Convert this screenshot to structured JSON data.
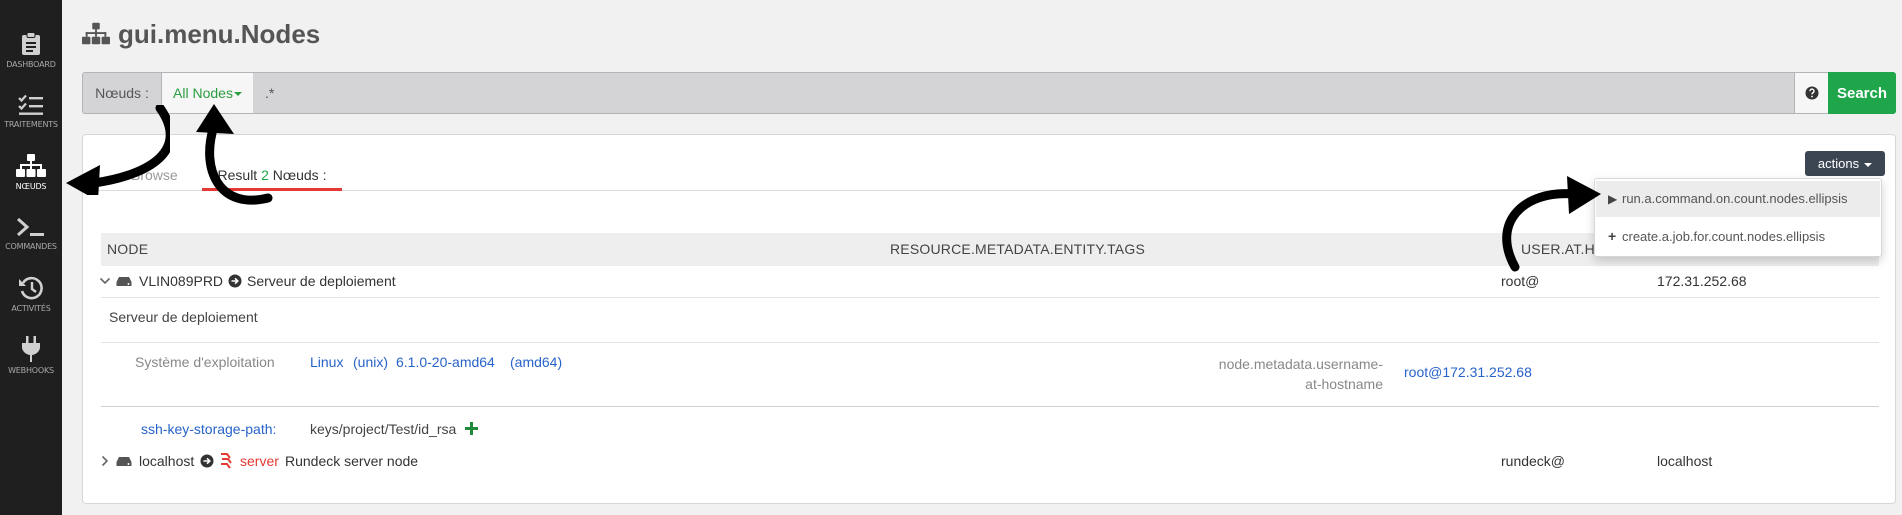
{
  "sidebar": {
    "items": [
      {
        "label": "DASHBOARD",
        "icon": "clipboard-icon"
      },
      {
        "label": "TRAITEMENTS",
        "icon": "checklist-icon"
      },
      {
        "label": "NŒUDS",
        "icon": "sitemap-icon"
      },
      {
        "label": "COMMANDES",
        "icon": "terminal-icon"
      },
      {
        "label": "ACTIVITÉS",
        "icon": "history-icon"
      },
      {
        "label": "WEBHOOKS",
        "icon": "plug-icon"
      }
    ],
    "active": "NŒUDS"
  },
  "page": {
    "title": "gui.menu.Nodes"
  },
  "filter": {
    "label": "Nœuds :",
    "dropdown": "All Nodes",
    "value": ".*",
    "search_label": "Search"
  },
  "tabs": {
    "browse": "Browse",
    "result_prefix": "Result",
    "result_count": "2",
    "result_suffix": "Nœuds :"
  },
  "actions": {
    "label": "actions",
    "items": [
      {
        "icon": "play-icon",
        "label": "run.a.command.on.count.nodes.ellipsis"
      },
      {
        "icon": "plus-icon",
        "label": "create.a.job.for.count.nodes.ellipsis"
      }
    ]
  },
  "table": {
    "columns": [
      "NODE",
      "RESOURCE.METADATA.ENTITY.TAGS",
      "USER.AT.HOST"
    ],
    "nodes": [
      {
        "name": "VLIN089PRD",
        "description": "Serveur de deploiement",
        "user_at": "root@",
        "host": "172.31.252.68",
        "details": {
          "description": "Serveur de deploiement",
          "os_label": "Système d'exploitation",
          "os": {
            "family": "Linux",
            "name": "(unix)",
            "version": "6.1.0-20-amd64",
            "arch": "(amd64)"
          },
          "username_label": "node.metadata.username-at-hostname",
          "username_label_line1": "node.metadata.username-",
          "username_label_line2": "at-hostname",
          "username_value": "root@172.31.252.68",
          "ssh_key_label": "ssh-key-storage-path:",
          "ssh_key_value": "keys/project/Test/id_rsa"
        }
      },
      {
        "name": "localhost",
        "tag": "server",
        "description": "Rundeck server node",
        "user_at": "rundeck@",
        "host": "localhost"
      }
    ]
  },
  "colors": {
    "sidebar_bg": "#1f1f1f",
    "accent_green": "#1fa64a",
    "link_blue": "#2763c9",
    "tab_underline": "#e53935",
    "server_tag": "#e53935"
  }
}
